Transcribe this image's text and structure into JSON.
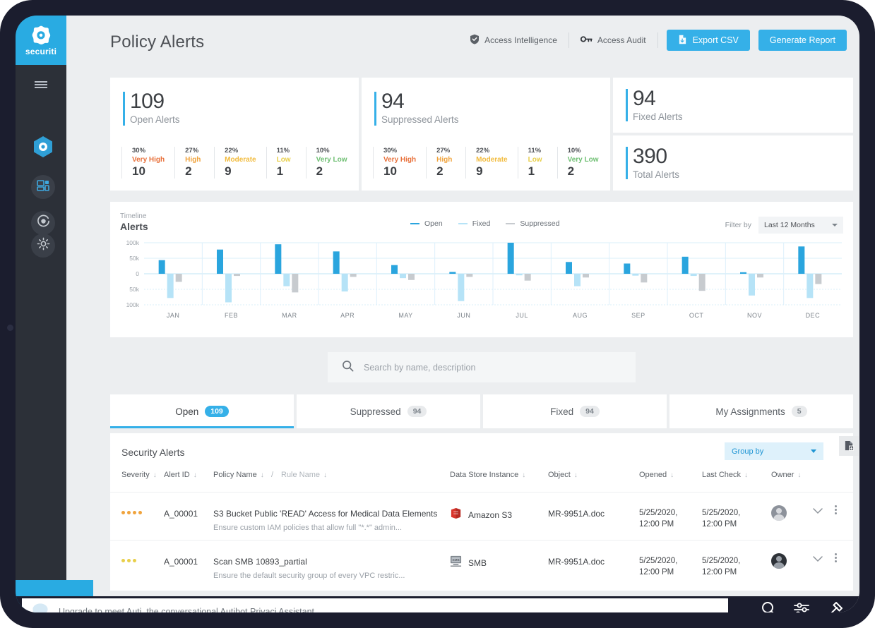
{
  "brand": {
    "name": "securiti",
    "logo_icon": "securiti-logo-icon",
    "accent": "#35b0e8"
  },
  "sidebar": {
    "menu_icon": "hamburger-icon",
    "items": [
      {
        "icon": "hexagon-shield-icon",
        "name": "dashboard",
        "active": true
      },
      {
        "icon": "data-map-icon",
        "name": "data-mapping",
        "active": false
      },
      {
        "icon": "target-icon",
        "name": "privacy-ops",
        "active": false
      },
      {
        "icon": "settings-gear-icon",
        "name": "settings",
        "active": false
      }
    ]
  },
  "header": {
    "title": "Policy Alerts",
    "links": [
      {
        "label": "Access Intelligence",
        "icon": "shield-check-icon"
      },
      {
        "label": "Access Audit",
        "icon": "key-icon"
      }
    ],
    "buttons": [
      {
        "label": "Export CSV",
        "icon": "export-file-icon"
      },
      {
        "label": "Generate Report",
        "icon": "none"
      }
    ]
  },
  "stats": {
    "open": {
      "value": "109",
      "label": "Open Alerts",
      "severities": [
        {
          "pct": "30%",
          "name": "Very High",
          "value": "10",
          "color": "#e8703a"
        },
        {
          "pct": "27%",
          "name": "High",
          "value": "2",
          "color": "#f0a33c"
        },
        {
          "pct": "22%",
          "name": "Moderate",
          "value": "9",
          "color": "#f2bb3d"
        },
        {
          "pct": "11%",
          "name": "Low",
          "value": "1",
          "color": "#e8cf4a"
        },
        {
          "pct": "10%",
          "name": "Very Low",
          "value": "2",
          "color": "#6fbf73"
        }
      ]
    },
    "suppressed": {
      "value": "94",
      "label": "Suppressed Alerts",
      "severities": [
        {
          "pct": "30%",
          "name": "Very High",
          "value": "10",
          "color": "#e8703a"
        },
        {
          "pct": "27%",
          "name": "High",
          "value": "2",
          "color": "#f0a33c"
        },
        {
          "pct": "22%",
          "name": "Moderate",
          "value": "9",
          "color": "#f2bb3d"
        },
        {
          "pct": "11%",
          "name": "Low",
          "value": "1",
          "color": "#e8cf4a"
        },
        {
          "pct": "10%",
          "name": "Very Low",
          "value": "2",
          "color": "#6fbf73"
        }
      ]
    },
    "fixed": {
      "value": "94",
      "label": "Fixed Alerts"
    },
    "total": {
      "value": "390",
      "label": "Total Alerts"
    }
  },
  "timeline": {
    "subtitle": "Timeline",
    "title": "Alerts",
    "filter_label": "Filter by",
    "filter_value": "Last 12 Months"
  },
  "chart_data": {
    "type": "bar",
    "title": "Alerts",
    "subtitle": "Timeline",
    "xlabel": "",
    "ylabel": "",
    "ylim": [
      -100000,
      100000
    ],
    "ytick_labels": [
      "100k",
      "50k",
      "0",
      "50k",
      "100k"
    ],
    "ytick_values": [
      100000,
      50000,
      0,
      -50000,
      -100000
    ],
    "grid": true,
    "legend_position": "top-center",
    "categories": [
      "JAN",
      "FEB",
      "MAR",
      "APR",
      "MAY",
      "JUN",
      "JUL",
      "AUG",
      "SEP",
      "OCT",
      "NOV",
      "DEC"
    ],
    "series": [
      {
        "name": "Open",
        "color": "#2aa5de",
        "values": [
          44000,
          78000,
          95000,
          72000,
          28000,
          6000,
          100000,
          38000,
          33000,
          55000,
          5000,
          88000
        ]
      },
      {
        "name": "Fixed",
        "color": "#b6e3f7",
        "values": [
          -78000,
          -92000,
          -40000,
          -57000,
          -14000,
          -88000,
          -5000,
          -40000,
          -6000,
          -7000,
          -70000,
          -78000
        ]
      },
      {
        "name": "Suppressed",
        "color": "#c7cbcf",
        "values": [
          -26000,
          -7000,
          -60000,
          -10000,
          -20000,
          -10000,
          -22000,
          -12000,
          -28000,
          -55000,
          -12000,
          -33000
        ]
      }
    ]
  },
  "search": {
    "placeholder": "Search by name, description",
    "icon": "search-icon"
  },
  "tabs": [
    {
      "label": "Open",
      "count": "109",
      "active": true
    },
    {
      "label": "Suppressed",
      "count": "94",
      "active": false
    },
    {
      "label": "Fixed",
      "count": "94",
      "active": false
    },
    {
      "label": "My Assignments",
      "count": "5",
      "active": false
    }
  ],
  "table": {
    "title": "Security Alerts",
    "group_by_label": "Group by",
    "column_icon": "columns-settings-icon",
    "columns": [
      {
        "label": "Severity",
        "muted": false
      },
      {
        "label": "Alert ID",
        "muted": false
      },
      {
        "label": "Policy Name",
        "muted": false
      },
      {
        "label": "Rule Name",
        "muted": true
      },
      {
        "label": "Data Store Instance",
        "muted": false
      },
      {
        "label": "Object",
        "muted": false
      },
      {
        "label": "Opened",
        "muted": false
      },
      {
        "label": "Last Check",
        "muted": false
      },
      {
        "label": "Owner",
        "muted": false
      }
    ],
    "separator": "/",
    "rows": [
      {
        "severity_dots": 4,
        "severity_color": "#f0a33c",
        "alert_id": "A_00001",
        "policy_name": "S3 Bucket Public 'READ' Access for Medical Data Elements",
        "policy_desc": "Ensure custom IAM policies that allow full \"*.*\" admin...",
        "data_store": "Amazon S3",
        "data_store_icon": "amazon-s3-icon",
        "object": "MR-9951A.doc",
        "opened_date": "5/25/2020,",
        "opened_time": "12:00 PM",
        "last_check_date": "5/25/2020,",
        "last_check_time": "12:00 PM",
        "owner_icon": "user-avatar"
      },
      {
        "severity_dots": 3,
        "severity_color": "#e8cf4a",
        "alert_id": "A_00001",
        "policy_name": "Scan SMB 10893_partial",
        "policy_desc": "Ensure the default security group of every VPC restric...",
        "data_store": "SMB",
        "data_store_icon": "smb-icon",
        "object": "MR-9951A.doc",
        "opened_date": "5/25/2020,",
        "opened_time": "12:00 PM",
        "last_check_date": "5/25/2020,",
        "last_check_time": "12:00 PM",
        "owner_icon": "user-avatar"
      }
    ]
  },
  "assistant": {
    "placeholder": "Upgrade to meet Auti, the conversational Autibot Privaci Assistant.",
    "bubble_icon": "chat-bubble-icon",
    "icons": [
      "search-icon",
      "sliders-icon",
      "hammer-icon"
    ]
  }
}
